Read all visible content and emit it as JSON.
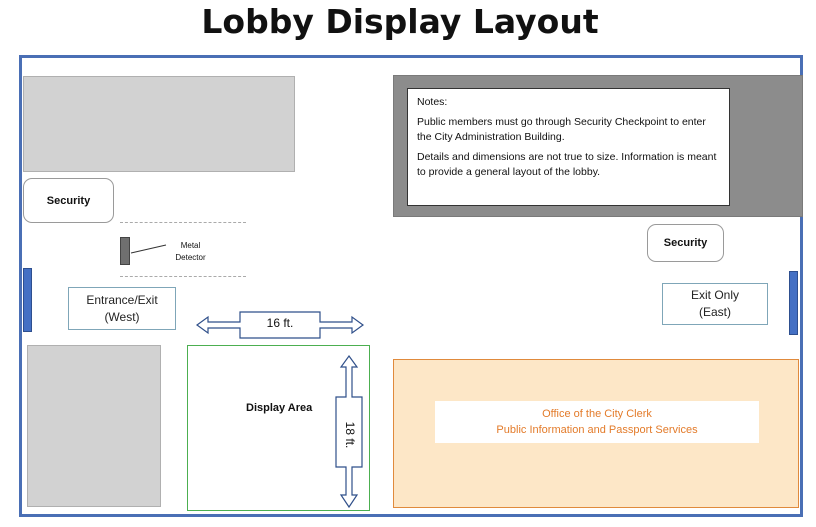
{
  "title": "Lobby Display Layout",
  "notes": {
    "heading": "Notes:",
    "line1": "Public members must go through Security Checkpoint to enter the City Administration Building.",
    "line2": "Details and dimensions are not true to size. Information is meant to provide a general layout of the lobby."
  },
  "security_west": "Security",
  "security_east": "Security",
  "metal_detector": {
    "line1": "Metal",
    "line2": "Detector"
  },
  "entrance_west": {
    "line1": "Entrance/Exit",
    "line2": "(West)"
  },
  "exit_east": {
    "line1": "Exit Only",
    "line2": "(East)"
  },
  "width_dimension": "16 ft.",
  "height_dimension": "18 ft.",
  "display_area": "Display Area",
  "clerk_office": {
    "line1": "Office of the City Clerk",
    "line2": "Public Information and Passport Services"
  },
  "colors": {
    "frame": "#4a6fb5",
    "door": "#4470c4",
    "display_border": "#4caf50",
    "clerk_fill": "#fde7c7",
    "clerk_border": "#e08a3c",
    "clerk_text": "#e37b2a",
    "notes_panel": "#8c8c8c"
  }
}
